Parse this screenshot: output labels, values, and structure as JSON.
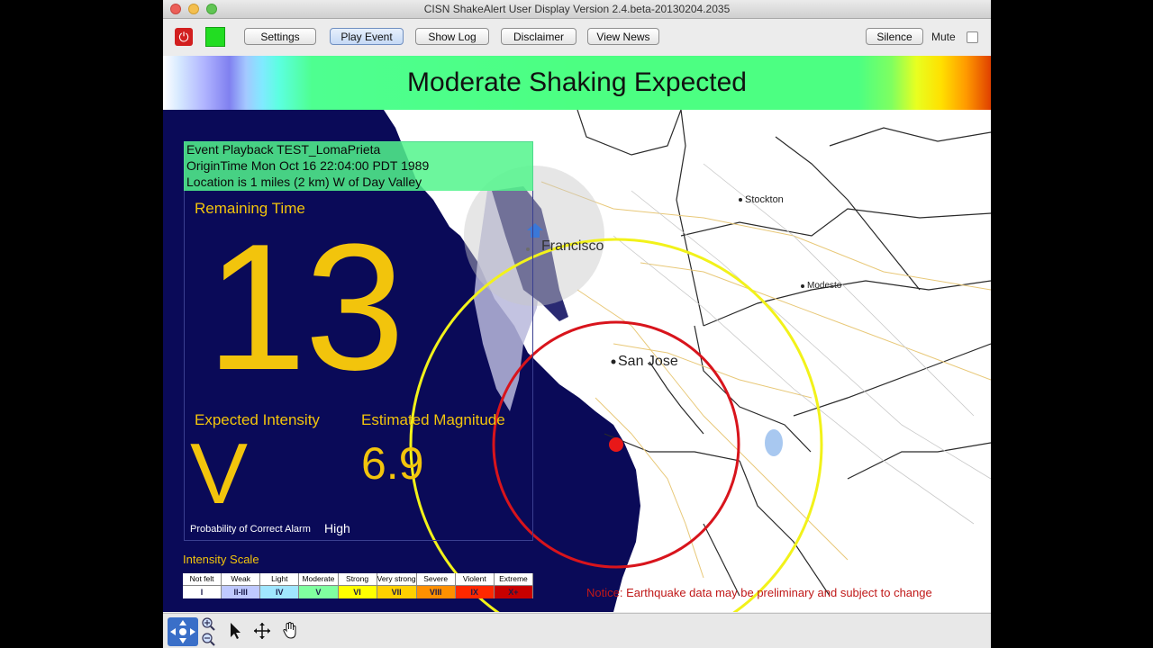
{
  "window": {
    "title": "CISN ShakeAlert User Display Version 2.4.beta-20130204.2035"
  },
  "toolbar": {
    "buttons": [
      {
        "label": "Settings"
      },
      {
        "label": "Play Event"
      },
      {
        "label": "Show Log"
      },
      {
        "label": "Disclaimer"
      },
      {
        "label": "View News"
      }
    ],
    "silence_label": "Silence",
    "mute_label": "Mute",
    "mute_checked": false,
    "status_color": "#22dd22"
  },
  "banner": {
    "text": "Moderate Shaking Expected"
  },
  "event": {
    "line1": "Event Playback TEST_LomaPrieta",
    "line2": "OriginTime Mon Oct 16 22:04:00 PDT 1989",
    "line3": "Location is 1 miles (2 km) W of Day Valley"
  },
  "countdown": {
    "label": "Remaining Time",
    "value": "13"
  },
  "intensity": {
    "label": "Expected Intensity",
    "value": "V"
  },
  "magnitude": {
    "label": "Estimated Magnitude",
    "value": "6.9"
  },
  "probability": {
    "label": "Probability of Correct Alarm",
    "value": "High"
  },
  "intensity_scale": {
    "title": "Intensity Scale",
    "levels": [
      {
        "name": "Not felt",
        "roman": "I",
        "color": "#ffffff"
      },
      {
        "name": "Weak",
        "roman": "II-III",
        "color": "#bfc9ff"
      },
      {
        "name": "Light",
        "roman": "IV",
        "color": "#a0e6ff"
      },
      {
        "name": "Moderate",
        "roman": "V",
        "color": "#80ffa0"
      },
      {
        "name": "Strong",
        "roman": "VI",
        "color": "#ffff00"
      },
      {
        "name": "Very strong",
        "roman": "VII",
        "color": "#ffd000"
      },
      {
        "name": "Severe",
        "roman": "VIII",
        "color": "#ff9000"
      },
      {
        "name": "Violent",
        "roman": "IX",
        "color": "#ff2800"
      },
      {
        "name": "Extreme",
        "roman": "X+",
        "color": "#c80000"
      }
    ]
  },
  "map": {
    "cities": [
      {
        "name": "Stockton"
      },
      {
        "name": "Modesto"
      },
      {
        "name": "San Jose"
      },
      {
        "name": "Francisco"
      }
    ]
  },
  "notice": "Notice: Earthquake data may be preliminary and subject to change",
  "colors": {
    "panel_bg": "#0a0a58",
    "accent_yellow": "#f2c40c",
    "p_wave": "#f2f21a",
    "s_wave": "#d8141c",
    "epicenter": "#e81818"
  }
}
